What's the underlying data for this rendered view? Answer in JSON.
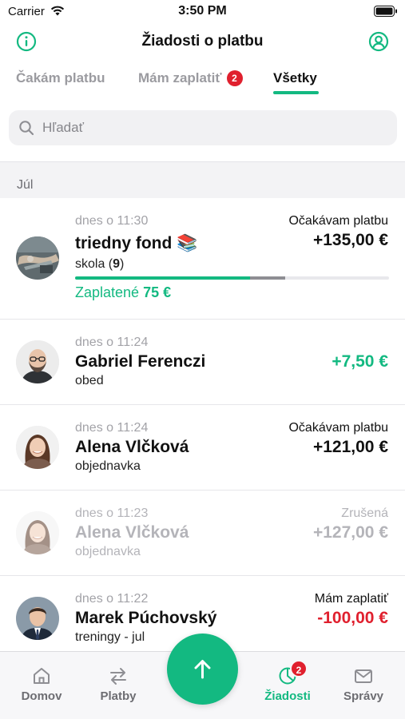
{
  "status_bar": {
    "carrier": "Carrier",
    "time": "3:50 PM"
  },
  "header": {
    "title": "Žiadosti o platbu",
    "left_icon": "info-icon",
    "right_icon": "user-icon"
  },
  "tabs": [
    {
      "label": "Čakám platbu",
      "active": false
    },
    {
      "label": "Mám zaplatiť",
      "badge": "2",
      "active": false
    },
    {
      "label": "Všetky",
      "active": true
    }
  ],
  "search": {
    "placeholder": "Hľadať"
  },
  "section": {
    "label": "Júl"
  },
  "requests": [
    {
      "time": "dnes o 11:30",
      "name": "triedny fond 📚",
      "subtitle_prefix": "skola (",
      "subtitle_count": "9",
      "subtitle_suffix": ")",
      "status": "Očakávam platbu",
      "amount": "+135,00 €",
      "paid_prefix": "Zaplatené",
      "paid_amount": "75 €",
      "progress_paid_fraction": 0.556,
      "progress_pending_fraction": 0.111
    },
    {
      "time": "dnes o 11:24",
      "name": "Gabriel Ferenczi",
      "subtitle": "obed",
      "status": "",
      "amount": "+7,50 €"
    },
    {
      "time": "dnes o 11:24",
      "name": "Alena Vlčková",
      "subtitle": "objednavka",
      "status": "Očakávam platbu",
      "amount": "+121,00 €"
    },
    {
      "time": "dnes o 11:23",
      "name": "Alena Vlčková",
      "subtitle": "objednavka",
      "status": "Zrušená",
      "amount": "+127,00 €"
    },
    {
      "time": "dnes o 11:22",
      "name": "Marek Púchovský",
      "subtitle": "treningy - jul",
      "status": "Mám zaplatiť",
      "amount": "-100,00 €"
    }
  ],
  "tabbar": {
    "items": [
      {
        "label": "Domov",
        "icon": "home-icon"
      },
      {
        "label": "Platby",
        "icon": "transfer-icon"
      },
      {
        "label": "Žiadosti",
        "icon": "requests-icon",
        "badge": "2",
        "active": true
      },
      {
        "label": "Správy",
        "icon": "mail-icon"
      }
    ],
    "fab_icon": "arrow-up-icon"
  },
  "colors": {
    "accent": "#13b981",
    "danger": "#e0202e",
    "muted": "#a3a3a8"
  }
}
